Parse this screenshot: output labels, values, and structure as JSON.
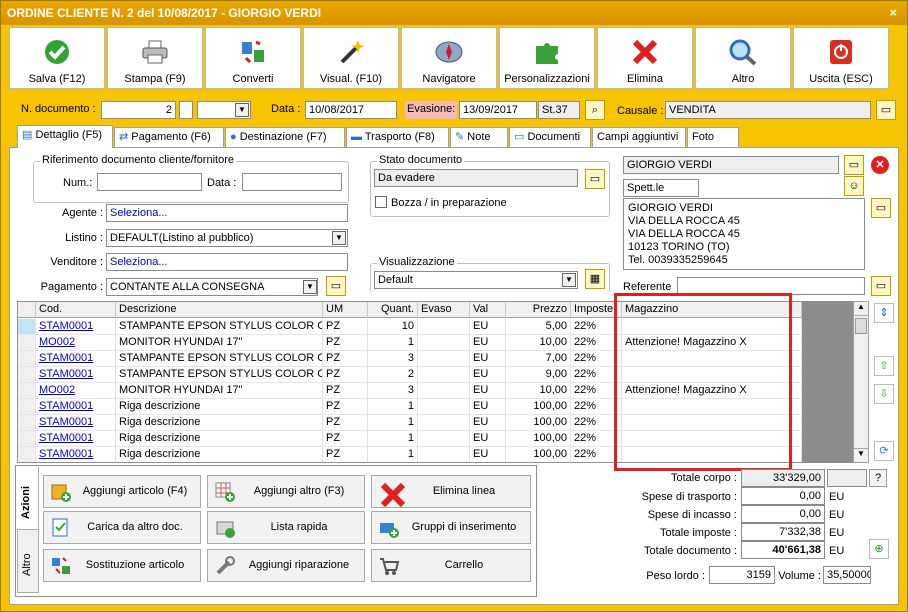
{
  "window": {
    "title": "ORDINE CLIENTE N. 2 del 10/08/2017 - GIORGIO VERDI",
    "close": "×"
  },
  "toolbar": [
    {
      "label": "Salva (F12)",
      "icon": "check-icon"
    },
    {
      "label": "Stampa (F9)",
      "icon": "printer-icon"
    },
    {
      "label": "Converti",
      "icon": "convert-icon"
    },
    {
      "label": "Visual. (F10)",
      "icon": "magic-wand-icon"
    },
    {
      "label": "Navigatore",
      "icon": "compass-icon"
    },
    {
      "label": "Personalizzazioni",
      "icon": "puzzle-icon"
    },
    {
      "label": "Elimina",
      "icon": "delete-x-icon"
    },
    {
      "label": "Altro",
      "icon": "magnifier-icon"
    },
    {
      "label": "Uscita (ESC)",
      "icon": "power-icon"
    }
  ],
  "header": {
    "ndoc_label": "N. documento :",
    "ndoc": "2",
    "data_label": "Data :",
    "data": "10/08/2017",
    "evasione_label": "Evasione:",
    "evasione": "13/09/2017",
    "settimana": "St.37",
    "causale_label": "Causale :",
    "causale": "VENDITA"
  },
  "tabs": [
    "Dettaglio (F5)",
    "Pagamento (F6)",
    "Destinazione (F7)",
    "Trasporto (F8)",
    "Note",
    "Documenti",
    "Campi aggiuntivi",
    "Foto"
  ],
  "rif": {
    "title": "Riferimento documento cliente/fornitore",
    "num_label": "Num.:",
    "data_label": "Data :"
  },
  "stato": {
    "title": "Stato documento",
    "value": "Da evadere",
    "bozza": "Bozza / in preparazione"
  },
  "fields": {
    "agente_label": "Agente :",
    "agente": "Seleziona...",
    "listino_label": "Listino :",
    "listino": "DEFAULT(Listino al pubblico)",
    "venditore_label": "Venditore :",
    "venditore": "Seleziona...",
    "pagamento_label": "Pagamento :",
    "pagamento": "CONTANTE ALLA CONSEGNA"
  },
  "visual": {
    "title": "Visualizzazione",
    "value": "Default"
  },
  "cliente": {
    "name": "GIORGIO VERDI",
    "spett": "Spett.le",
    "address": [
      "GIORGIO VERDI",
      "VIA DELLA ROCCA 45",
      "VIA DELLA ROCCA 45",
      "10123 TORINO (TO)",
      "Tel. 0039335259645"
    ],
    "referente_label": "Referente"
  },
  "grid": {
    "headers": [
      "Cod.",
      "Descrizione",
      "UM",
      "Quant.",
      "Evaso",
      "Val",
      "Prezzo",
      "Imposte",
      "Magazzino"
    ],
    "rows": [
      [
        "STAM0001",
        "STAMPANTE EPSON STYLUS COLOR C...",
        "PZ",
        "10",
        "",
        "EU",
        "5,00",
        "22%",
        ""
      ],
      [
        "MO002",
        "MONITOR HYUNDAI 17\"",
        "PZ",
        "1",
        "",
        "EU",
        "10,00",
        "22%",
        "Attenzione! Magazzino X"
      ],
      [
        "STAM0001",
        "STAMPANTE EPSON STYLUS COLOR C...",
        "PZ",
        "3",
        "",
        "EU",
        "7,00",
        "22%",
        ""
      ],
      [
        "STAM0001",
        "STAMPANTE EPSON STYLUS COLOR C...",
        "PZ",
        "2",
        "",
        "EU",
        "9,00",
        "22%",
        ""
      ],
      [
        "MO002",
        "MONITOR HYUNDAI 17\"",
        "PZ",
        "3",
        "",
        "EU",
        "10,00",
        "22%",
        "Attenzione! Magazzino X"
      ],
      [
        "STAM0001",
        "Riga descrizione",
        "PZ",
        "1",
        "",
        "EU",
        "100,00",
        "22%",
        ""
      ],
      [
        "STAM0001",
        "Riga descrizione",
        "PZ",
        "1",
        "",
        "EU",
        "100,00",
        "22%",
        ""
      ],
      [
        "STAM0001",
        "Riga descrizione",
        "PZ",
        "1",
        "",
        "EU",
        "100,00",
        "22%",
        ""
      ],
      [
        "STAM0001",
        "Riga descrizione",
        "PZ",
        "1",
        "",
        "EU",
        "100,00",
        "22%",
        ""
      ]
    ]
  },
  "side_tabs": [
    "Azioni",
    "Altro"
  ],
  "actions": [
    {
      "label": "Aggiungi articolo (F4)",
      "icon": "add-box-icon"
    },
    {
      "label": "Aggiungi altro (F3)",
      "icon": "add-grid-icon"
    },
    {
      "label": "Elimina linea",
      "icon": "delete-x-icon"
    },
    {
      "label": "Carica da altro doc.",
      "icon": "load-doc-icon"
    },
    {
      "label": "Lista rapida",
      "icon": "quick-list-icon"
    },
    {
      "label": "Gruppi di inserimento",
      "icon": "group-add-icon"
    },
    {
      "label": "Sostituzione articolo",
      "icon": "replace-icon"
    },
    {
      "label": "Aggiungi riparazione",
      "icon": "wrench-icon"
    },
    {
      "label": "Carrello",
      "icon": "cart-icon"
    }
  ],
  "totals": {
    "corpo_label": "Totale corpo :",
    "corpo": "33'329,00",
    "help": "?",
    "trasporto_label": "Spese di trasporto :",
    "trasporto": "0,00",
    "incasso_label": "Spese di incasso :",
    "incasso": "0,00",
    "imposte_label": "Totale imposte :",
    "imposte": "7'332,38",
    "documento_label": "Totale documento :",
    "documento": "40'661,38",
    "cur": "EU",
    "peso_label": "Peso lordo :",
    "peso": "3159",
    "volume_label": "Volume :",
    "volume": "35,50000"
  },
  "colors": {
    "frame": "#f6c400",
    "highlight": "#e0201c",
    "link": "#0000d0"
  }
}
